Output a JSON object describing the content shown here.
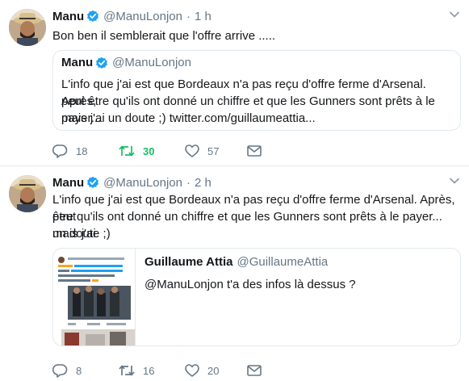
{
  "tweets": [
    {
      "name": "Manu",
      "handle": "@ManuLonjon",
      "separator": "·",
      "time": "1 h",
      "text": "Bon ben il semblerait que l'offre arrive .....",
      "quote": {
        "name": "Manu",
        "handle": "@ManuLonjon",
        "line1": "L'info que j'ai est que Bordeaux n'a pas reçu d'offre ferme d'Arsenal. Après,",
        "line2": "peut être qu'ils ont donné un chiffre et que les Gunners sont prêts à le payer...",
        "line3": "mais j'ai un doute ;) twitter.com/guillaumeattia..."
      },
      "replies": "18",
      "retweets": "30",
      "likes": "57"
    },
    {
      "name": "Manu",
      "handle": "@ManuLonjon",
      "separator": "·",
      "time": "2 h",
      "line1": "L'info que j'ai est que Bordeaux n'a pas reçu d'offre ferme d'Arsenal. Après, peut",
      "line2": "être qu'ils ont donné un chiffre et que les Gunners sont prêts à le payer... mais j'ai",
      "line3": "un doute ;)",
      "quote": {
        "name": "Guillaume Attia",
        "handle": "@GuillaumeAttia",
        "text": "@ManuLonjon  t'a des infos là dessus ?"
      },
      "replies": "8",
      "retweets": "16",
      "likes": "20"
    }
  ],
  "colors": {
    "accent": "#1da1f2",
    "retweet": "#17bf63",
    "secondary": "#657786",
    "border": "#e1e8ed"
  },
  "icons": [
    "verified-badge-icon",
    "chevron-down-icon",
    "reply-icon",
    "retweet-icon",
    "like-icon",
    "direct-message-icon"
  ]
}
